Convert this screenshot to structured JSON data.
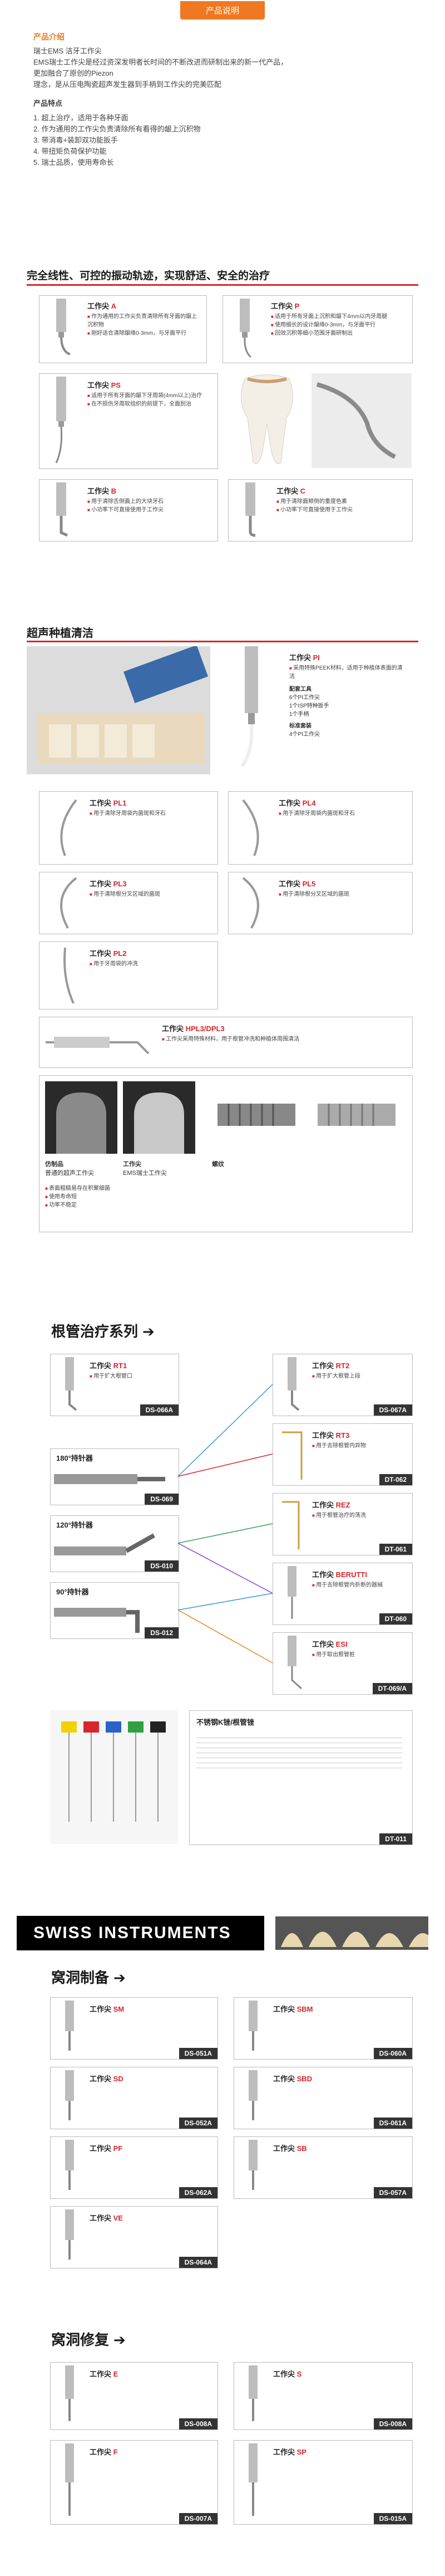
{
  "header": {
    "title": "产品说明"
  },
  "intro": {
    "heading": "产品介绍",
    "lines": [
      "瑞士EMS 洁牙工作尖",
      "EMS瑞士工作尖是经过资深发明者长时间的不断改进而研制出来的新一代产品，",
      "更加融合了原创的Piezon",
      "理念，是从压电陶瓷超声发生器到手柄到工作尖的完美匹配"
    ]
  },
  "features": {
    "heading": "产品特点",
    "items": [
      "1. 超上治疗，适用于各种牙面",
      "2. 作为通用的工作尖负责清除所有看得的龈上沉积物",
      "3. 带消毒+装卸双功能扳手",
      "4. 带扭矩负荷保护功能",
      "5. 瑞士品质，使用寿命长"
    ]
  },
  "section1": {
    "title": "完全线性、可控的振动轨迹，实现舒适、安全的治疗",
    "tipA": {
      "prefix": "工作尖",
      "name": "A",
      "bullets": [
        "作为通用的工作尖负责清除所有牙面的龈上沉积物",
        "刚好适合清除龈缘0-3mm，与牙面平行"
      ]
    },
    "tipP": {
      "prefix": "工作尖",
      "name": "P",
      "bullets": [
        "适用于所有牙面上沉积和龈下4mm以内牙周腿",
        "使用细长的设计龈缘0-3mm，与牙面平行",
        "回效沉积等细小范围牙面研制出"
      ]
    },
    "tipPS": {
      "prefix": "工作尖",
      "name": "PS",
      "bullets": [
        "适用于所有牙面的龈下牙周袋(4mm以上)治疗",
        "在不损伤牙周软组织的前提下，全面刮治"
      ]
    },
    "tipB": {
      "prefix": "工作尖",
      "name": "B",
      "bullets": [
        "用于清除舌侧面上的大块牙石",
        "小功率下可直接使用于工作尖"
      ]
    },
    "tipC": {
      "prefix": "工作尖",
      "name": "C",
      "bullets": [
        "用于清除面颊侧的重度色素",
        "小功率下可直接使用于工作尖"
      ]
    }
  },
  "section2": {
    "title": "超声种植清洁",
    "tipPI": {
      "prefix": "工作尖",
      "name": "PI",
      "bullets": [
        "采用特殊PEEK材料，适用于种植体表面的清洁"
      ],
      "sub": [
        "配套工具",
        "6个PI工作尖",
        "1个ISP特种扳手",
        "1个手柄",
        "标准套装",
        "4个PI工作尖"
      ]
    },
    "tipPL1": {
      "prefix": "工作尖",
      "name": "PL1",
      "bullets": [
        "用于清除牙周袋内菌斑和牙石"
      ]
    },
    "tipPL4": {
      "prefix": "工作尖",
      "name": "PL4",
      "bullets": [
        "用于清除牙周袋内菌斑和牙石"
      ]
    },
    "tipPL3": {
      "prefix": "工作尖",
      "name": "PL3",
      "bullets": [
        "用于清除根分叉区域的菌斑"
      ]
    },
    "tipPL5": {
      "prefix": "工作尖",
      "name": "PL5",
      "bullets": [
        "用于清除根分叉区域的菌斑"
      ]
    },
    "tipPL2": {
      "prefix": "工作尖",
      "name": "PL2",
      "bullets": [
        "用于牙周袋的冲洗"
      ]
    },
    "tipHPL3": {
      "prefix": "工作尖",
      "name": "HPL3/DPL3",
      "bullets": [
        "工作尖采用特殊材料，用于根管冲洗和种植体周围清洁"
      ]
    },
    "compare": {
      "left": "仿制品",
      "leftSub": "普通的超声工作尖",
      "right": "工作尖",
      "rightSub": "EMS瑞士工作尖",
      "thread": "螺纹",
      "bullets": [
        "表面粗糙易存在积聚细菌",
        "使用寿命短",
        "功率不稳定"
      ]
    }
  },
  "section3": {
    "title": "根管治疗系列",
    "tips": [
      {
        "name": "RT1",
        "code": "DS-066A",
        "bullets": [
          "用于扩大根管口"
        ]
      },
      {
        "name": "RT2",
        "code": "DS-067A",
        "bullets": [
          "用于扩大根管上段"
        ]
      },
      {
        "name": "RT3",
        "code": "DT-062",
        "bullets": [
          "用于去除根管内异物"
        ]
      },
      {
        "name": "REZ",
        "code": "DT-061",
        "bullets": [
          "用于根管治疗的荡洗"
        ]
      },
      {
        "name": "BERUTTI",
        "code": "DT-060",
        "bullets": [
          "用于去除根管内折断的器械"
        ]
      },
      {
        "name": "ESI",
        "code": "DT-069/A",
        "bullets": [
          "用于取出根管桩"
        ]
      }
    ],
    "holders": [
      {
        "name": "180°持针器",
        "code": "DS-069"
      },
      {
        "name": "120°持针器",
        "code": "DS-010"
      },
      {
        "name": "90°持针器",
        "code": "DS-012"
      }
    ],
    "files": {
      "title": "不锈钢K锉/根管锉",
      "code": "DT-011"
    }
  },
  "swiss": {
    "label": "SWISS INSTRUMENTS"
  },
  "section4": {
    "title": "窝洞制备",
    "tips": [
      {
        "name": "SM",
        "code": "DS-051A"
      },
      {
        "name": "SBM",
        "code": "DS-060A"
      },
      {
        "name": "SD",
        "code": "DS-052A"
      },
      {
        "name": "SBD",
        "code": "DS-061A"
      },
      {
        "name": "PF",
        "code": "DS-062A"
      },
      {
        "name": "SB",
        "code": "DS-057A"
      },
      {
        "name": "VE",
        "code": "DS-064A"
      }
    ]
  },
  "section5": {
    "title": "窝洞修复",
    "tips": [
      {
        "name": "E",
        "code": "DS-008A"
      },
      {
        "name": "S",
        "code": "DS-008A"
      },
      {
        "name": "F",
        "code": "DS-007A"
      },
      {
        "name": "SP",
        "code": "DS-015A"
      }
    ]
  },
  "colors": {
    "accent": "#f07820",
    "red": "#d8262c",
    "dark": "#1a1a1a"
  }
}
